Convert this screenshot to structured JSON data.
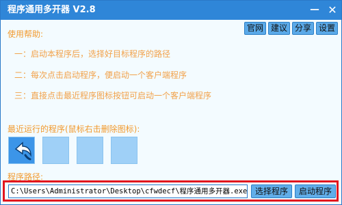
{
  "window": {
    "title": "程序通用多开器 V2.8",
    "minimize_glyph": "－",
    "close_glyph": "✕"
  },
  "menu": [
    "官网",
    "建议",
    "分享",
    "设置"
  ],
  "help": {
    "title": "使用帮助:",
    "lines": [
      "一：启动本程序后，选择好目标程序的路径",
      "二：每次点击启动程序，便启动一个客户端程序",
      "三：直接点击最近程序图标按钮可启动一个客户端程序"
    ]
  },
  "recent": {
    "title": "最近运行的程序(鼠标右击删除图标):",
    "tiles": [
      {
        "icon": "return-arrow-icon"
      },
      {
        "icon": ""
      },
      {
        "icon": ""
      },
      {
        "icon": ""
      }
    ]
  },
  "path": {
    "label": "程序路径:",
    "value": "C:\\Users\\Administrator\\Desktop\\cfwdecf\\程序通用多开器.exe",
    "choose_label": "选择程序",
    "launch_label": "启动程序"
  },
  "colors": {
    "titlebar": "#2f86d8",
    "accent_text": "#f29a2e",
    "highlight_border": "#e2141d",
    "tile": "#9fd0f7"
  }
}
